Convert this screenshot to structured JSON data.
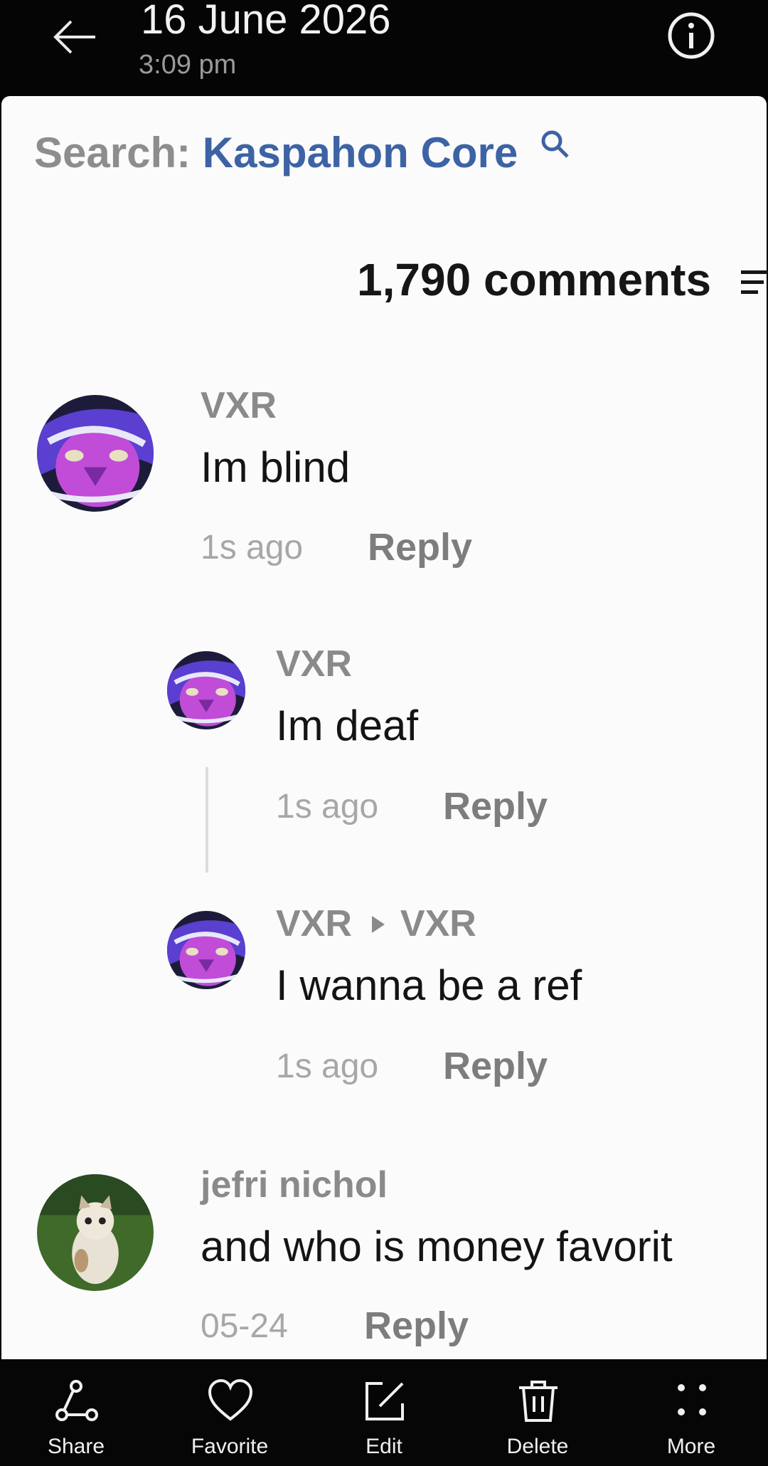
{
  "header": {
    "date": "16 June 2026",
    "time": "3:09 pm"
  },
  "content": {
    "search_label": "Search:",
    "search_term": "Kaspahon Core",
    "comments_count": "1,790 comments",
    "comments": [
      {
        "user": "VXR",
        "text": "Im blind",
        "time": "1s ago",
        "reply": "Reply"
      },
      {
        "user": "VXR",
        "text": "Im deaf",
        "time": "1s ago",
        "reply": "Reply"
      },
      {
        "user": "VXR",
        "reply_to": "VXR",
        "text": "I wanna be a ref",
        "time": "1s ago",
        "reply": "Reply"
      },
      {
        "user": "jefri nichol",
        "text": "and who is money favorit",
        "time": "05-24",
        "reply": "Reply"
      }
    ]
  },
  "actions": [
    {
      "label": "Share",
      "icon": "share-icon"
    },
    {
      "label": "Favorite",
      "icon": "heart-icon"
    },
    {
      "label": "Edit",
      "icon": "edit-icon"
    },
    {
      "label": "Delete",
      "icon": "trash-icon"
    },
    {
      "label": "More",
      "icon": "more-icon"
    }
  ],
  "colors": {
    "search_term": "#3d63a5",
    "header_bg": "#050505",
    "photo_bg": "#fbfbfb"
  }
}
